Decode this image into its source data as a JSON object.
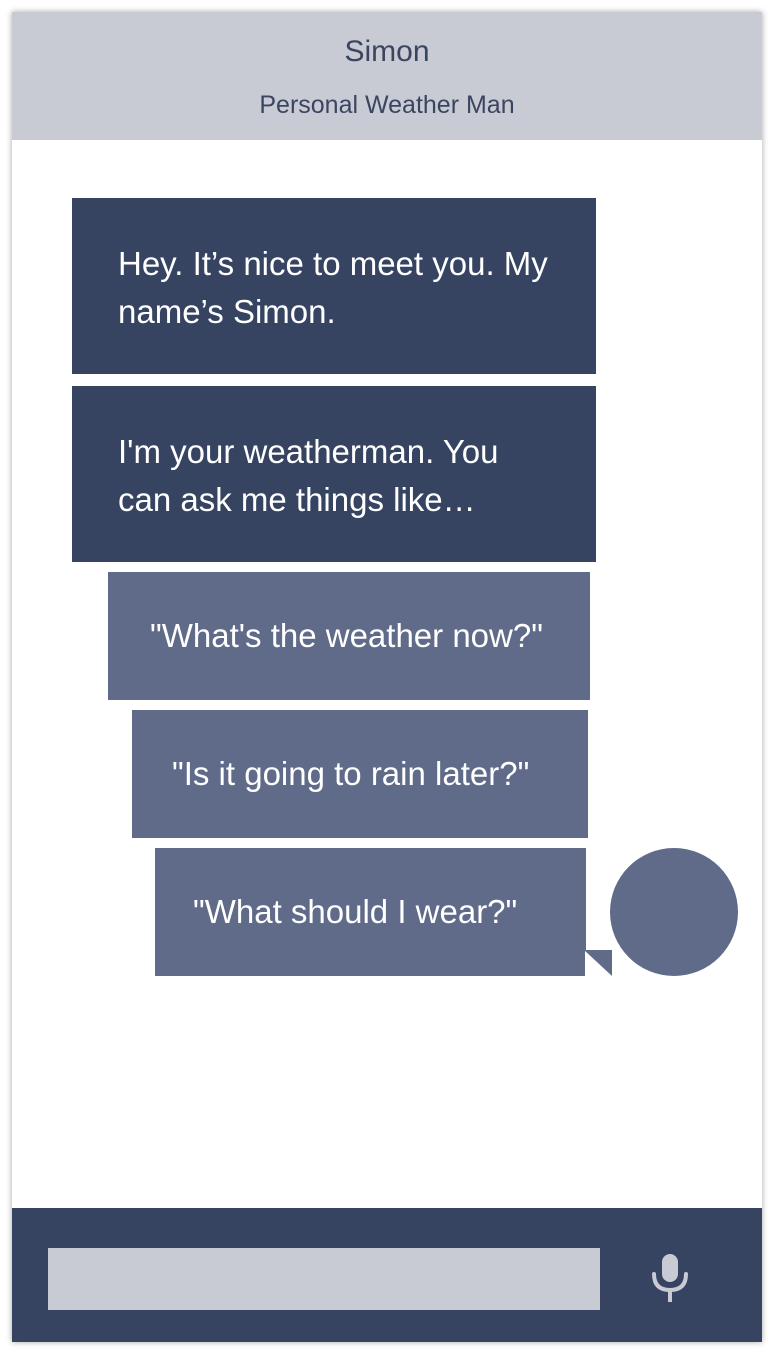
{
  "header": {
    "title": "Simon",
    "subtitle": "Personal Weather Man"
  },
  "messages": [
    {
      "type": "bot",
      "text": "Hey. It’s nice to meet you. My name’s Simon."
    },
    {
      "type": "bot",
      "text": "I'm your weatherman. You can ask me things like…"
    }
  ],
  "suggestions": [
    {
      "text": "\"What's the weather now?\""
    },
    {
      "text": "\"Is it going to rain later?\""
    },
    {
      "text": "\"What should I wear?\""
    }
  ],
  "composer": {
    "value": "",
    "placeholder": "",
    "mic_icon": "microphone-icon"
  },
  "colors": {
    "header_bg": "#c8cbd4",
    "header_text": "#3a4560",
    "bot_bubble": "#364462",
    "suggestion_bubble": "#5f6b89",
    "footer_bg": "#364462",
    "input_bg": "#c8cbd4",
    "mic_icon": "#c8cbd4"
  }
}
